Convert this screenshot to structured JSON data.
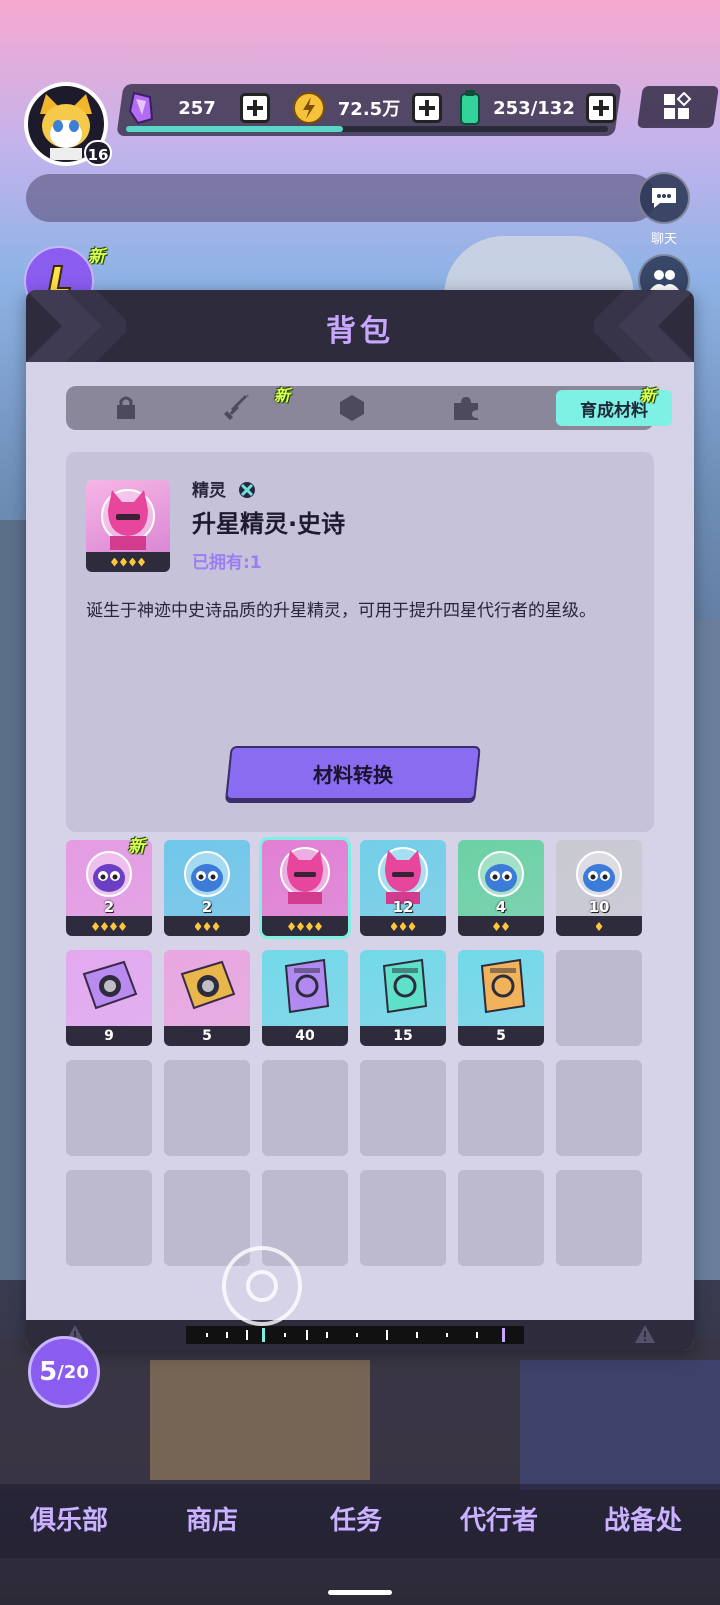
{
  "player": {
    "level": "16"
  },
  "resources": [
    {
      "name": "gem",
      "icon": "purple-crystal-icon",
      "value": "257"
    },
    {
      "name": "coin",
      "icon": "gold-coin-icon",
      "value": "72.5万"
    },
    {
      "name": "energy",
      "icon": "green-battery-icon",
      "value": "253/132"
    }
  ],
  "xp_fraction": 0.45,
  "side": {
    "chat_label": "聊天"
  },
  "new_tag": "新",
  "panel": {
    "title": "背包",
    "tabs": [
      {
        "icon": "lock-icon"
      },
      {
        "icon": "sword-icon",
        "new": true
      },
      {
        "icon": "hexagon-icon"
      },
      {
        "icon": "puzzle-icon"
      },
      {
        "label": "育成材料",
        "active": true,
        "new": true
      }
    ],
    "detail": {
      "category": "精灵",
      "name": "升星精灵·史诗",
      "owned": "已拥有:1",
      "stars": 4,
      "description": "诞生于神迹中史诗品质的升星精灵，可用于提升四星代行者的星级。",
      "convert_button": "材料转换"
    },
    "items": [
      {
        "icon": "purple-sprite-icon",
        "count": "2",
        "stars": 4,
        "color": "#e59be3",
        "new": true
      },
      {
        "icon": "blue-sprite-icon",
        "count": "2",
        "stars": 3,
        "color": "#6fc7ea"
      },
      {
        "icon": "pink-cat-sprite-icon",
        "count": "",
        "stars": 4,
        "color": "#e27fd4",
        "selected": true
      },
      {
        "icon": "pink-cat-sprite-icon",
        "count": "12",
        "stars": 3,
        "color": "#72cfe8"
      },
      {
        "icon": "green-eye-sprite-icon",
        "count": "4",
        "stars": 2,
        "color": "#6ad2a4"
      },
      {
        "icon": "grey-eye-sprite-icon",
        "count": "10",
        "stars": 1,
        "color": "#c9c9d2"
      },
      {
        "icon": "purple-chip-icon",
        "count": "9",
        "color": "#e3a9f0"
      },
      {
        "icon": "gold-chip-icon",
        "count": "5",
        "color": "#e9a6e0"
      },
      {
        "icon": "purple-card-icon",
        "count": "40",
        "color": "#72d9e9"
      },
      {
        "icon": "teal-card-icon",
        "count": "15",
        "color": "#72d9e9"
      },
      {
        "icon": "orange-card-icon",
        "count": "5",
        "color": "#72d9e9"
      }
    ]
  },
  "counter": {
    "current": "5",
    "total": "/20"
  },
  "nav": [
    "俱乐部",
    "商店",
    "任务",
    "代行者",
    "战备处"
  ]
}
